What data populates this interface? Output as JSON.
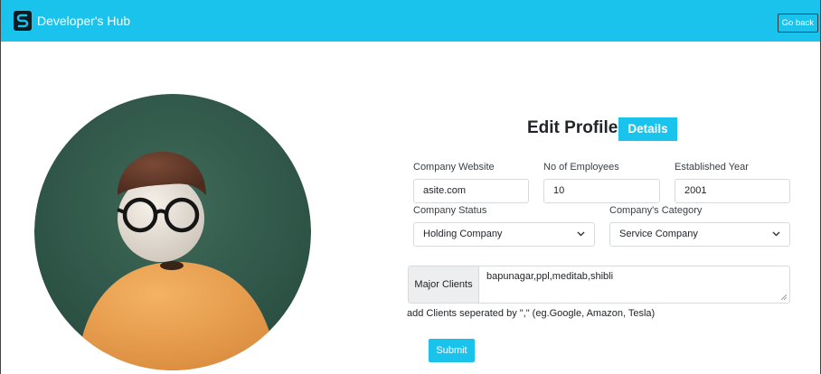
{
  "navbar": {
    "brand_name": "Developer's Hub",
    "go_back_label": "Go back",
    "bg_color": "#1ac3ec"
  },
  "form": {
    "title": "Edit Profile",
    "title_badge": "Details",
    "company_website": {
      "label": "Company Website",
      "value": "asite.com"
    },
    "employees": {
      "label": "No of Employees",
      "value": "10"
    },
    "established_year": {
      "label": "Established Year",
      "value": "2001"
    },
    "company_status": {
      "label": "Company Status",
      "value": "Holding Company"
    },
    "company_category": {
      "label": "Company's Category",
      "value": "Service Company"
    },
    "major_clients": {
      "label": "Major Clients",
      "value": "bapunagar,ppl,meditab,shibli"
    },
    "clients_help": "add Clients seperated by \",\" (eg.Google, Amazon, Tesla)",
    "submit_label": "Submit"
  },
  "icons": {
    "brand": "logo-s-icon",
    "avatar": "user-avatar-illustration",
    "select_chevron": "chevron-down-icon"
  }
}
